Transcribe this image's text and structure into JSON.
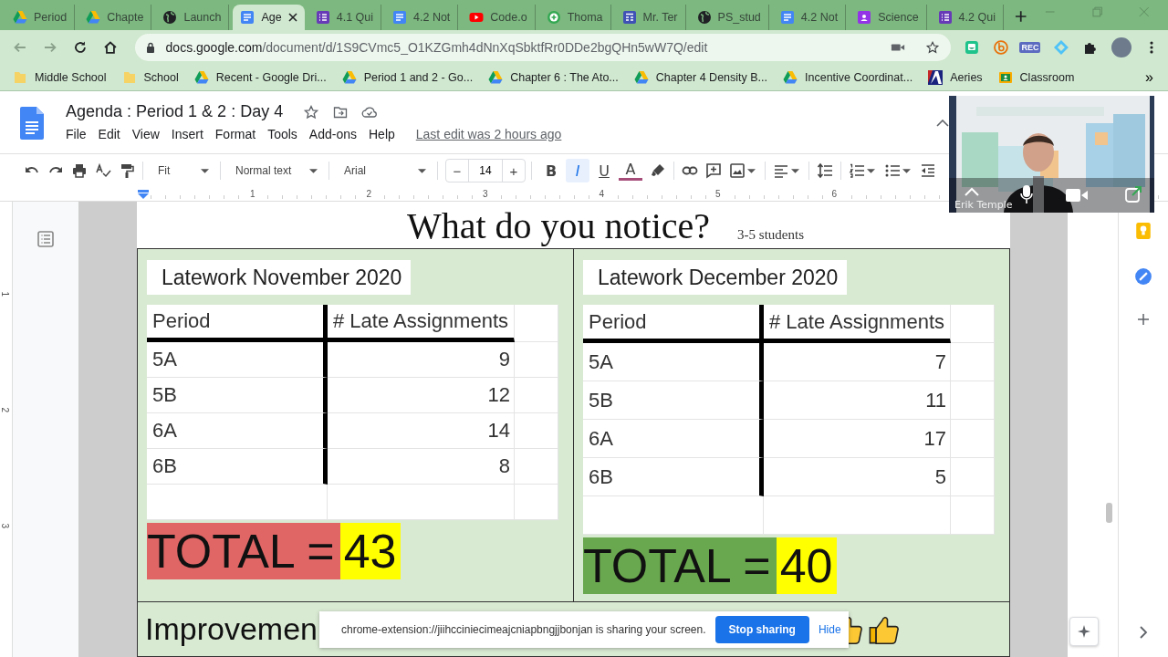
{
  "browser": {
    "tabs": [
      {
        "label": "Period",
        "selected": false
      },
      {
        "label": "Chapte",
        "selected": false
      },
      {
        "label": "Launch",
        "selected": false
      },
      {
        "label": "Age",
        "selected": true
      },
      {
        "label": "4.1 Qui",
        "selected": false
      },
      {
        "label": "4.2 Not",
        "selected": false
      },
      {
        "label": "Code.o",
        "selected": false
      },
      {
        "label": "Thoma",
        "selected": false
      },
      {
        "label": "Mr. Ter",
        "selected": false
      },
      {
        "label": "PS_stud",
        "selected": false
      },
      {
        "label": "4.2 Not",
        "selected": false
      },
      {
        "label": "Science",
        "selected": false
      },
      {
        "label": "4.2 Qui",
        "selected": false
      }
    ],
    "address": {
      "host": "docs.google.com",
      "path": "/document/d/1S9CVmc5_O1KZGmh4dNnXqSbktfRr0DDe2bgQHn5wW7Q/edit"
    },
    "rec_badge": "REC",
    "bookmarks": [
      {
        "label": "Middle School"
      },
      {
        "label": "School"
      },
      {
        "label": "Recent - Google Dri..."
      },
      {
        "label": "Period 1 and 2 - Go..."
      },
      {
        "label": "Chapter 6 : The Ato..."
      },
      {
        "label": "Chapter 4 Density B..."
      },
      {
        "label": "Incentive Coordinat..."
      },
      {
        "label": "Aeries"
      },
      {
        "label": "Classroom"
      }
    ],
    "bookmarks_more": "»"
  },
  "doc": {
    "title": "Agenda : Period 1 & 2 : Day 4",
    "menu": [
      "File",
      "Edit",
      "View",
      "Insert",
      "Format",
      "Tools",
      "Add-ons",
      "Help"
    ],
    "last_edit": "Last edit was 2 hours ago",
    "toolbar": {
      "zoom": "Fit",
      "style": "Normal text",
      "font": "Arial",
      "size": "14",
      "minus": "−",
      "plus": "+",
      "format": [
        {
          "label": "B",
          "selected": false
        },
        {
          "label": "I",
          "selected": true
        },
        {
          "label": "U",
          "selected": false
        }
      ],
      "text_color": "A"
    },
    "ruler": [
      "1",
      "2",
      "3",
      "4",
      "5",
      "6"
    ],
    "side_ruler": [
      "1",
      "2",
      "3"
    ]
  },
  "page": {
    "heading": "What do you notice?",
    "note": "3-5 students",
    "panels": [
      {
        "title": "Latework November 2020",
        "columns": [
          "Period",
          "# Late Assignments"
        ],
        "rows": [
          [
            "5A",
            "9"
          ],
          [
            "5B",
            "12"
          ],
          [
            "6A",
            "14"
          ],
          [
            "6B",
            "8"
          ]
        ],
        "total_label": "TOTAL =",
        "total": "43",
        "color": "#e06666"
      },
      {
        "title": "Latework December 2020",
        "columns": [
          "Period",
          "# Late Assignments"
        ],
        "rows": [
          [
            "5A",
            "7"
          ],
          [
            "5B",
            "11"
          ],
          [
            "6A",
            "17"
          ],
          [
            "6B",
            "5"
          ]
        ],
        "total_label": "TOTAL =",
        "total": "40",
        "color": "#6aa84f"
      }
    ],
    "improvement": "Improvemen"
  },
  "video": {
    "name": "Erik Temple"
  },
  "share_bar": {
    "message": "chrome-extension://jiihcciniecimeajcniapbngjjbonjan is sharing your screen.",
    "stop": "Stop sharing",
    "hide": "Hide"
  }
}
